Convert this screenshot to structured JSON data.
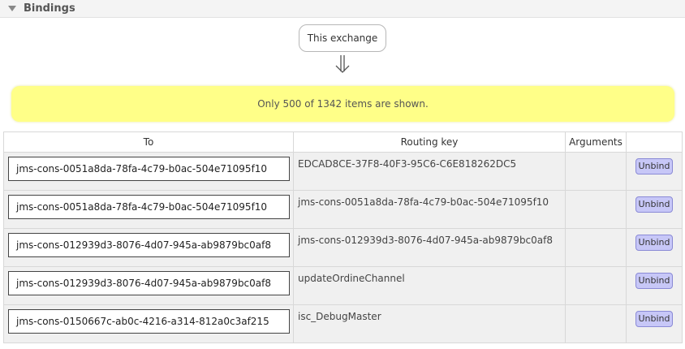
{
  "section": {
    "title": "Bindings"
  },
  "exchange": {
    "label": "This exchange"
  },
  "notice": {
    "text": "Only 500 of 1342 items are shown."
  },
  "table": {
    "headers": {
      "to": "To",
      "routing_key": "Routing key",
      "arguments": "Arguments"
    },
    "unbind_label": "Unbind",
    "rows": [
      {
        "to": "jms-cons-0051a8da-78fa-4c79-b0ac-504e71095f10",
        "routing_key": "EDCAD8CE-37F8-40F3-95C6-C6E818262DC5",
        "arguments": ""
      },
      {
        "to": "jms-cons-0051a8da-78fa-4c79-b0ac-504e71095f10",
        "routing_key": "jms-cons-0051a8da-78fa-4c79-b0ac-504e71095f10",
        "arguments": ""
      },
      {
        "to": "jms-cons-012939d3-8076-4d07-945a-ab9879bc0af8",
        "routing_key": "jms-cons-012939d3-8076-4d07-945a-ab9879bc0af8",
        "arguments": ""
      },
      {
        "to": "jms-cons-012939d3-8076-4d07-945a-ab9879bc0af8",
        "routing_key": "updateOrdineChannel",
        "arguments": ""
      },
      {
        "to": "jms-cons-0150667c-ab0c-4216-a314-812a0c3af215",
        "routing_key": "isc_DebugMaster",
        "arguments": ""
      }
    ]
  }
}
